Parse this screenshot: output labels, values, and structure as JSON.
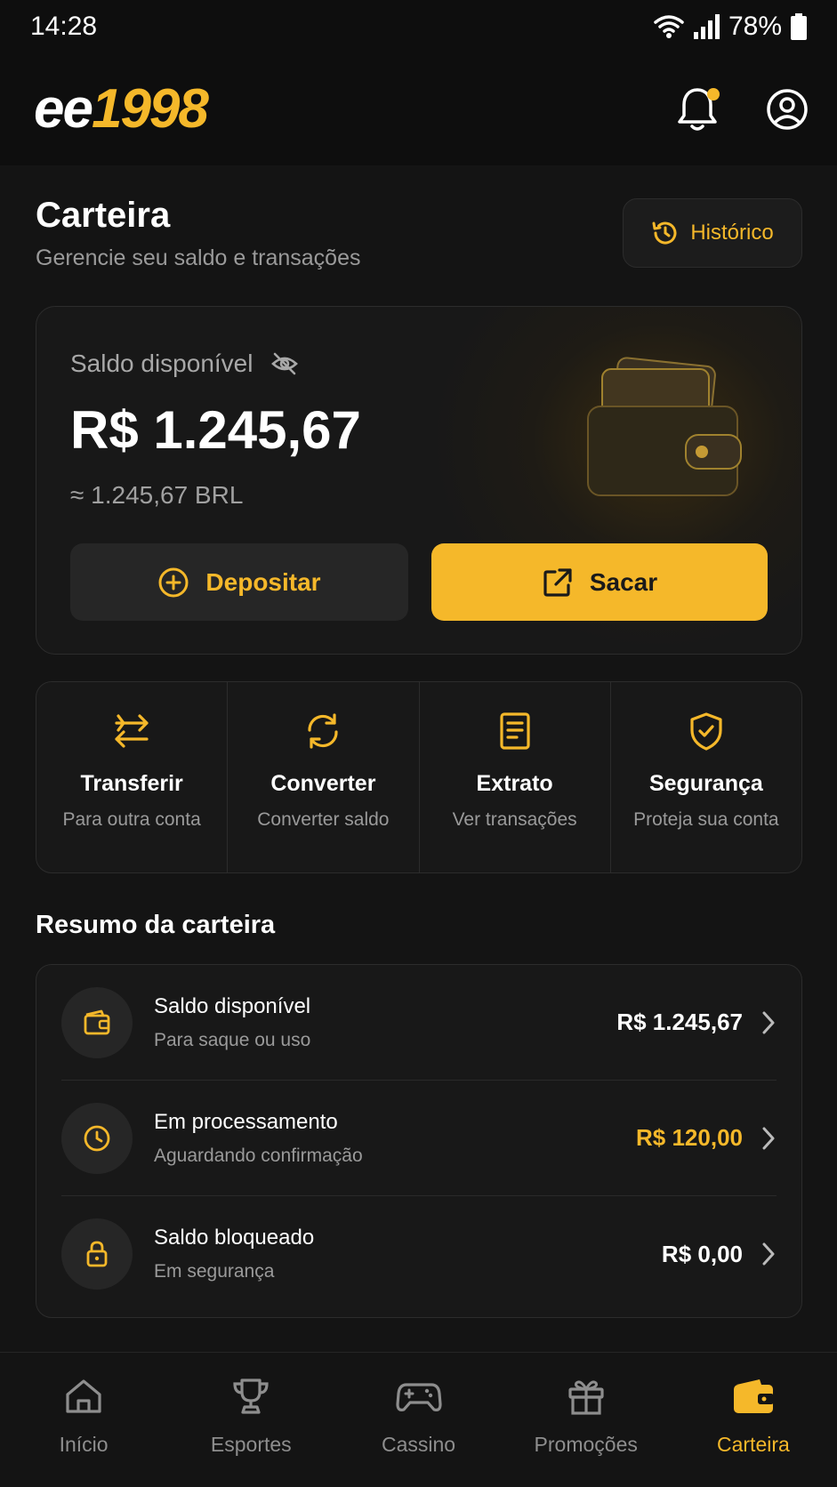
{
  "status_bar": {
    "time": "14:28",
    "battery": "78%"
  },
  "header": {
    "logo_white": "ee",
    "logo_accent": "1998"
  },
  "page": {
    "title": "Carteira",
    "subtitle": "Gerencie seu saldo e transações",
    "history_label": "Histórico"
  },
  "balance": {
    "label": "Saldo disponível",
    "value": "R$ 1.245,67",
    "approx": "≈ 1.245,67 BRL",
    "deposit_label": "Depositar",
    "withdraw_label": "Sacar"
  },
  "actions": [
    {
      "title": "Transferir",
      "subtitle": "Para outra conta",
      "icon": "transfer-icon"
    },
    {
      "title": "Converter",
      "subtitle": "Converter saldo",
      "icon": "refresh-icon"
    },
    {
      "title": "Extrato",
      "subtitle": "Ver transações",
      "icon": "document-icon"
    },
    {
      "title": "Segurança",
      "subtitle": "Proteja sua conta",
      "icon": "shield-icon"
    }
  ],
  "summary": {
    "title": "Resumo da carteira",
    "rows": [
      {
        "label": "Saldo disponível",
        "sub": "Para saque ou uso",
        "value": "R$ 1.245,67",
        "icon": "wallet-icon"
      },
      {
        "label": "Em processamento",
        "sub": "Aguardando confirmação",
        "value": "R$ 120,00",
        "icon": "clock-icon"
      },
      {
        "label": "Saldo bloqueado",
        "sub": "Em segurança",
        "value": "R$ 0,00",
        "icon": "lock-icon"
      }
    ]
  },
  "nav": [
    {
      "label": "Início",
      "icon": "home-icon"
    },
    {
      "label": "Esportes",
      "icon": "trophy-icon"
    },
    {
      "label": "Cassino",
      "icon": "gamepad-icon"
    },
    {
      "label": "Promoções",
      "icon": "gift-icon"
    },
    {
      "label": "Carteira",
      "icon": "wallet-icon",
      "active": true
    }
  ],
  "colors": {
    "accent": "#f5b82a",
    "background": "#141414",
    "card": "#181818"
  }
}
